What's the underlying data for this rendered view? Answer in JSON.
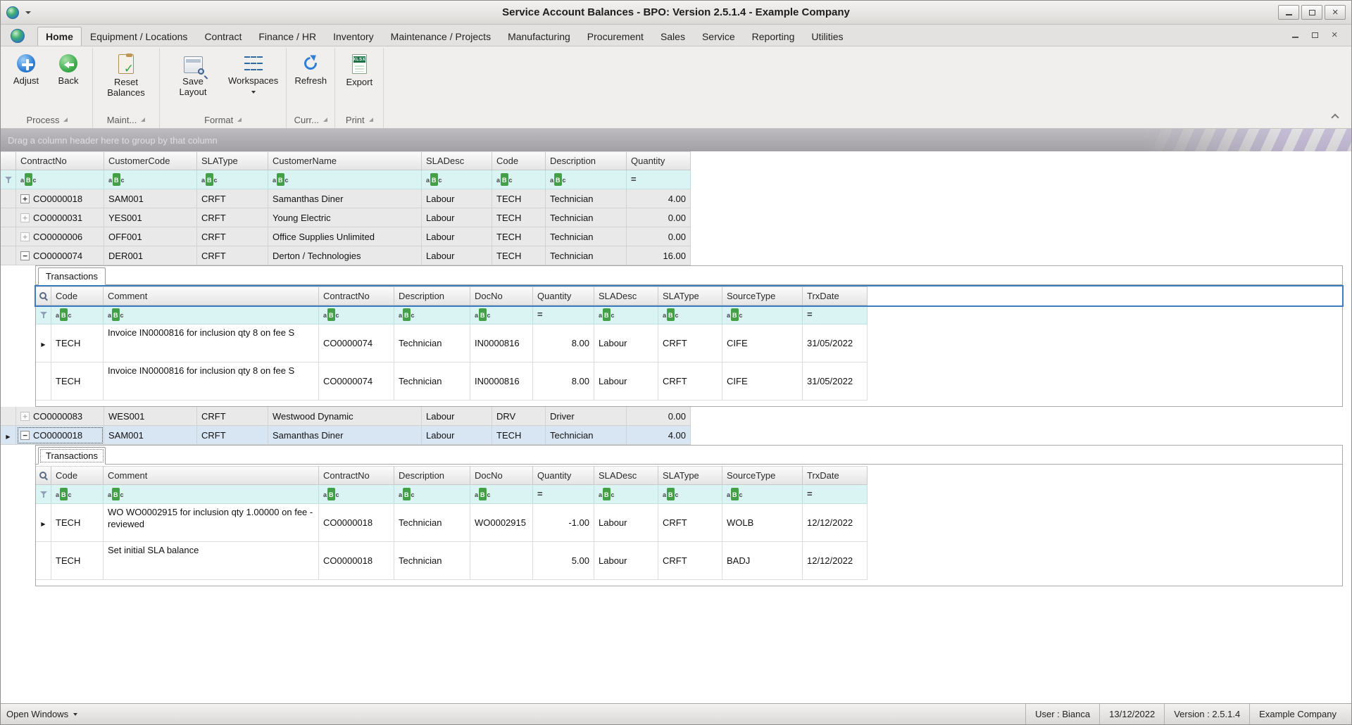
{
  "window": {
    "title": "Service Account Balances - BPO: Version 2.5.1.4 - Example Company"
  },
  "tabs": {
    "items": [
      "Home",
      "Equipment / Locations",
      "Contract",
      "Finance / HR",
      "Inventory",
      "Maintenance / Projects",
      "Manufacturing",
      "Procurement",
      "Sales",
      "Service",
      "Reporting",
      "Utilities"
    ],
    "active": "Home"
  },
  "ribbon": {
    "buttons": [
      {
        "label": "Adjust",
        "icon": "plus-circle-icon"
      },
      {
        "label": "Back",
        "icon": "back-circle-icon"
      },
      {
        "label": "Reset Balances",
        "icon": "clipboard-check-icon"
      },
      {
        "label": "Save Layout",
        "icon": "save-layout-magnifier-icon"
      },
      {
        "label": "Workspaces",
        "icon": "workspaces-grid-icon",
        "has_dropdown": true
      },
      {
        "label": "Refresh",
        "icon": "refresh-icon"
      },
      {
        "label": "Export",
        "icon": "export-xlsx-icon"
      }
    ],
    "groups": [
      {
        "label": "Process"
      },
      {
        "label": "Maint..."
      },
      {
        "label": "Format"
      },
      {
        "label": "Curr..."
      },
      {
        "label": "Print"
      }
    ]
  },
  "grid": {
    "group_panel_text": "Drag a column header here to group by that column",
    "columns": [
      "ContractNo",
      "CustomerCode",
      "SLAType",
      "CustomerName",
      "SLADesc",
      "Code",
      "Description",
      "Quantity"
    ],
    "rows": [
      {
        "cells": [
          "CO0000018",
          "SAM001",
          "CRFT",
          "Samanthas Diner",
          "Labour",
          "TECH",
          "Technician",
          "4.00"
        ]
      },
      {
        "cells": [
          "CO0000031",
          "YES001",
          "CRFT",
          "Young Electric",
          "Labour",
          "TECH",
          "Technician",
          "0.00"
        ]
      },
      {
        "cells": [
          "CO0000006",
          "OFF001",
          "CRFT",
          "Office Supplies Unlimited",
          "Labour",
          "TECH",
          "Technician",
          "0.00"
        ]
      },
      {
        "cells": [
          "CO0000074",
          "DER001",
          "CRFT",
          "Derton / Technologies",
          "Labour",
          "TECH",
          "Technician",
          "16.00"
        ]
      },
      {
        "cells": [
          "CO0000083",
          "WES001",
          "CRFT",
          "Westwood Dynamic",
          "Labour",
          "DRV",
          "Driver",
          "0.00"
        ]
      },
      {
        "cells": [
          "CO0000018",
          "SAM001",
          "CRFT",
          "Samanthas Diner",
          "Labour",
          "TECH",
          "Technician",
          "4.00"
        ]
      }
    ]
  },
  "detail": {
    "tab_label": "Transactions",
    "columns": [
      "Code",
      "Comment",
      "ContractNo",
      "Description",
      "DocNo",
      "Quantity",
      "SLADesc",
      "SLAType",
      "SourceType",
      "TrxDate"
    ],
    "grid1": {
      "rows": [
        {
          "cells": [
            "TECH",
            "Invoice IN0000816 for inclusion qty 8 on fee S",
            "CO0000074",
            "Technician",
            "IN0000816",
            "8.00",
            "Labour",
            "CRFT",
            "CIFE",
            "31/05/2022"
          ]
        },
        {
          "cells": [
            "TECH",
            "Invoice IN0000816 for inclusion qty 8 on fee S",
            "CO0000074",
            "Technician",
            "IN0000816",
            "8.00",
            "Labour",
            "CRFT",
            "CIFE",
            "31/05/2022"
          ]
        }
      ]
    },
    "grid2": {
      "rows": [
        {
          "cells": [
            "TECH",
            "WO WO0002915 for inclusion qty 1.00000 on fee - reviewed",
            "CO0000018",
            "Technician",
            "WO0002915",
            "-1.00",
            "Labour",
            "CRFT",
            "WOLB",
            "12/12/2022"
          ]
        },
        {
          "cells": [
            "TECH",
            "Set initial SLA balance",
            "CO0000018",
            "Technician",
            "",
            "5.00",
            "Labour",
            "CRFT",
            "BADJ",
            "12/12/2022"
          ]
        }
      ]
    }
  },
  "statusbar": {
    "open_windows": "Open Windows",
    "user": "User : Bianca",
    "date": "13/12/2022",
    "version": "Version : 2.5.1.4",
    "company": "Example Company"
  },
  "icons": {
    "app_icon": "globe-sphere",
    "quick_access_dropdown": "chevron-down",
    "minimize": "minimize-bar",
    "maximize": "restore-box",
    "close": "x",
    "text_filter": "aBc",
    "numeric_filter": "=",
    "expand": "+",
    "collapse": "−",
    "row_marker": "▶",
    "filter_row": "funnel",
    "search": "magnifier",
    "dialog_launcher": "corner-triangle",
    "collapse_ribbon": "chevron-up",
    "dropdown": "▼"
  }
}
